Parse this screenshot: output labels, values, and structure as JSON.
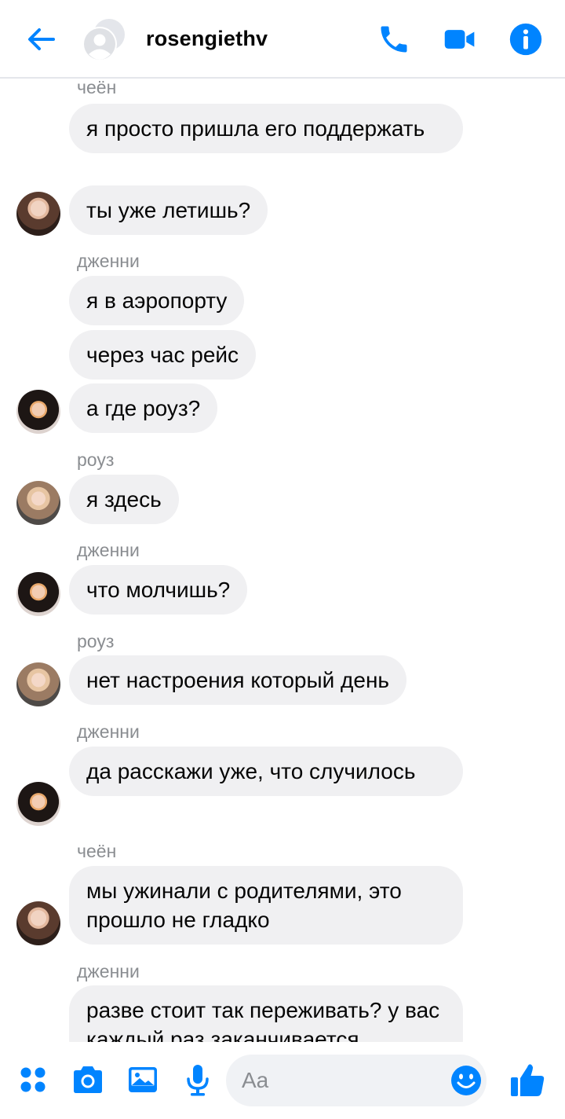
{
  "header": {
    "title": "rosengiethv"
  },
  "messages": [
    {
      "sender": "чеён",
      "text": "я просто пришла его поддержать",
      "avatar": "chaeyoung"
    },
    {
      "text": "ты уже летишь?",
      "avatar": "chaeyoung"
    },
    {
      "sender": "дженни",
      "text": "я в аэропорту",
      "avatar": "jennie"
    },
    {
      "text": "через час рейс",
      "avatar": "jennie"
    },
    {
      "text": "а где роуз?",
      "avatar": "jennie"
    },
    {
      "sender": "роуз",
      "text": "я здесь",
      "avatar": "rose"
    },
    {
      "sender": "дженни",
      "text": "что молчишь?",
      "avatar": "jennie"
    },
    {
      "sender": "роуз",
      "text": "нет настроения который день",
      "avatar": "rose"
    },
    {
      "sender": "дженни",
      "text": "да расскажи уже, что случилось",
      "avatar": "jennie"
    },
    {
      "sender": "чеён",
      "text": "мы ужинали с родителями, это прошло не гладко",
      "avatar": "chaeyoung"
    },
    {
      "sender": "дженни",
      "text": "разве стоит так переживать? у вас каждый раз заканчивается",
      "avatar": "jennie"
    }
  ],
  "composer": {
    "placeholder": "Aa"
  },
  "colors": {
    "accent": "#0084ff",
    "bubble": "#f0f0f2",
    "sender_label": "#8a8d91"
  },
  "icons": [
    "back-arrow-icon",
    "phone-icon",
    "video-camera-icon",
    "info-icon",
    "apps-icon",
    "camera-icon",
    "image-icon",
    "microphone-icon",
    "emoji-icon",
    "thumbs-up-icon"
  ]
}
